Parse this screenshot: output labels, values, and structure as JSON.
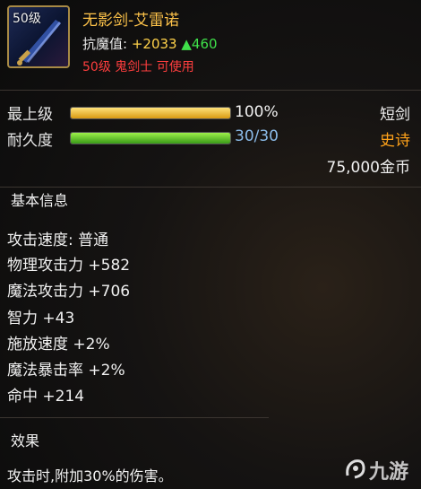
{
  "header": {
    "icon_level": "50级",
    "item_name": "无影剑-艾雷诺",
    "resist_label": "抗魔值:",
    "resist_value": "+2033",
    "resist_up": "▲460",
    "requirement": "50级 鬼剑士 可使用"
  },
  "stats": {
    "grade_label": "最上级",
    "grade_value": "100%",
    "grade_fraction": 1.0,
    "durability_label": "耐久度",
    "durability_value": "30/30",
    "durability_fraction": 1.0
  },
  "meta": {
    "weapon_type": "短剑",
    "rarity": "史诗",
    "price": "75,000金币"
  },
  "basic_info": {
    "title": "基本信息",
    "attributes": [
      "攻击速度: 普通",
      "物理攻击力 +582",
      "魔法攻击力 +706",
      "智力 +43",
      "施放速度 +2%",
      "魔法暴击率 +2%",
      "命中 +214"
    ]
  },
  "effect": {
    "title": "效果",
    "text": "攻击时,附加30%的伤害。"
  },
  "watermark": {
    "text": "九游"
  },
  "colors": {
    "item_name": "#ffc44a",
    "rarity_epic": "#ffa21a",
    "requirement": "#ff3e3e",
    "resist_up": "#3fe04a"
  }
}
